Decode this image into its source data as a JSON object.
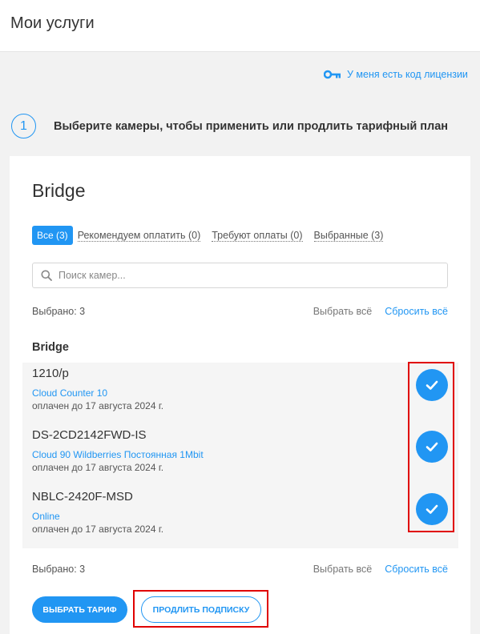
{
  "page": {
    "title": "Мои услуги"
  },
  "license": {
    "label": "У меня есть код лицензии",
    "icon": "key-icon"
  },
  "step": {
    "number": "1",
    "text": "Выберите камеры, чтобы применить или продлить тарифный план"
  },
  "card": {
    "title": "Bridge",
    "filters": [
      {
        "label": "Все (3)",
        "active": true
      },
      {
        "label": "Рекомендуем оплатить (0)",
        "active": false
      },
      {
        "label": "Требуют оплаты (0)",
        "active": false
      },
      {
        "label": "Выбранные (3)",
        "active": false
      }
    ],
    "search": {
      "placeholder": "Поиск камер...",
      "value": ""
    },
    "selection": {
      "count": "Выбрано: 3",
      "select_all": "Выбрать всё",
      "reset_all": "Сбросить всё"
    },
    "group_title": "Bridge",
    "cameras": [
      {
        "name": "1210/p",
        "plan": "Cloud Counter 10",
        "paid_until": "оплачен до 17 августа 2024 г.",
        "selected": true
      },
      {
        "name": "DS-2CD2142FWD-IS",
        "plan": "Cloud 90 Wildberries Постоянная 1Mbit",
        "paid_until": "оплачен до 17 августа 2024 г.",
        "selected": true
      },
      {
        "name": "NBLC-2420F-MSD",
        "plan": "Online",
        "paid_until": "оплачен до 17 августа 2024 г.",
        "selected": true
      }
    ],
    "buttons": {
      "choose_plan": "ВЫБРАТЬ ТАРИФ",
      "extend": "ПРОДЛИТЬ ПОДПИСКУ"
    }
  },
  "colors": {
    "accent": "#2196f3",
    "highlight": "#e00000",
    "background": "#f2f2f2"
  }
}
